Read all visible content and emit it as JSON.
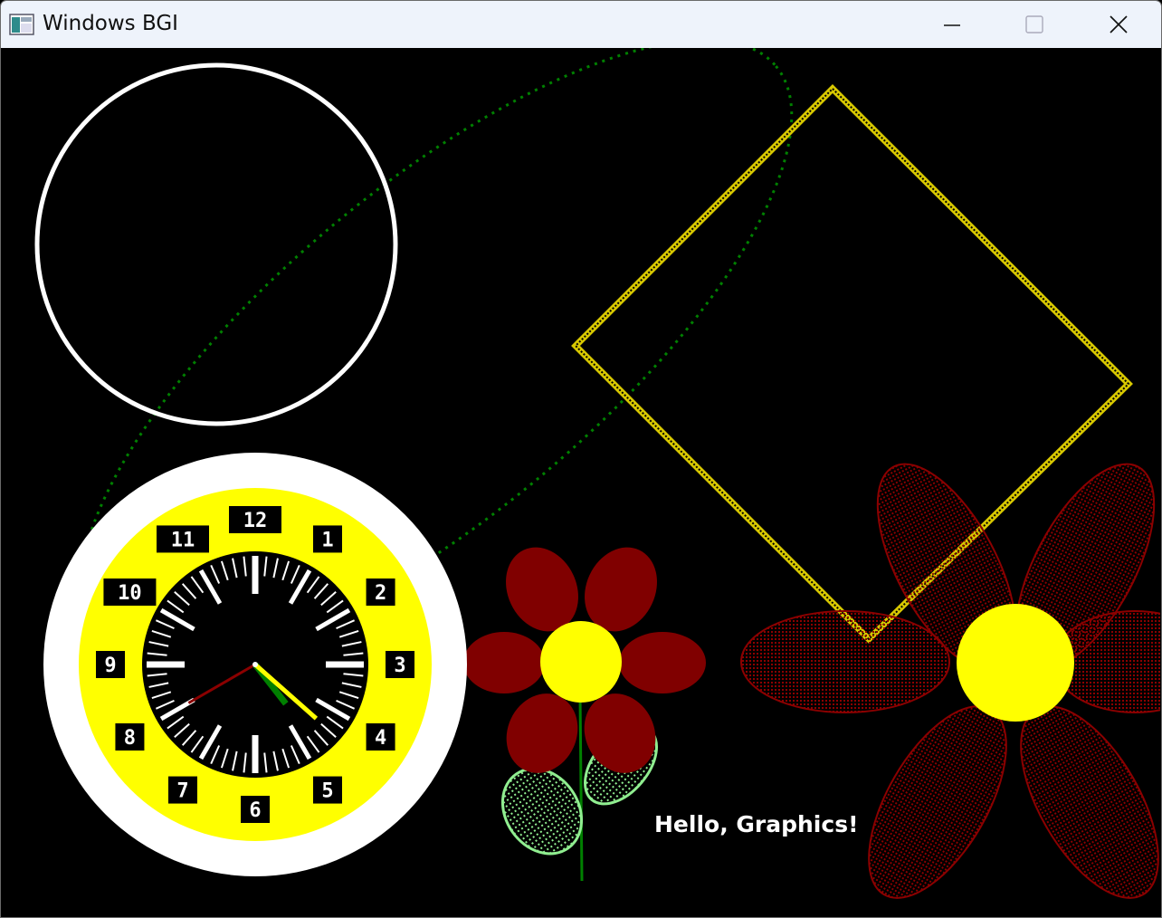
{
  "window": {
    "title": "Windows BGI",
    "controls": {
      "minimize": "minimize-icon",
      "maximize": "maximize-icon",
      "close": "close-icon"
    }
  },
  "canvas": {
    "background": "#000000",
    "text": "Hello, Graphics!",
    "clock": {
      "numerals": [
        "12",
        "1",
        "2",
        "3",
        "4",
        "5",
        "6",
        "7",
        "8",
        "9",
        "10",
        "11"
      ],
      "time_shown": {
        "hour": 4,
        "minute": 23,
        "second": 40
      },
      "ring_color": "#ffffff",
      "dial_color": "#ffff00",
      "face_color": "#000000"
    },
    "colors": {
      "circle": "#ffffff",
      "diamond": "#ffff00",
      "dotted_ellipse": "#008000",
      "petal": "#800000",
      "flower_center": "#ffff00",
      "leaf": "#90ee90",
      "stem": "#008000"
    }
  }
}
